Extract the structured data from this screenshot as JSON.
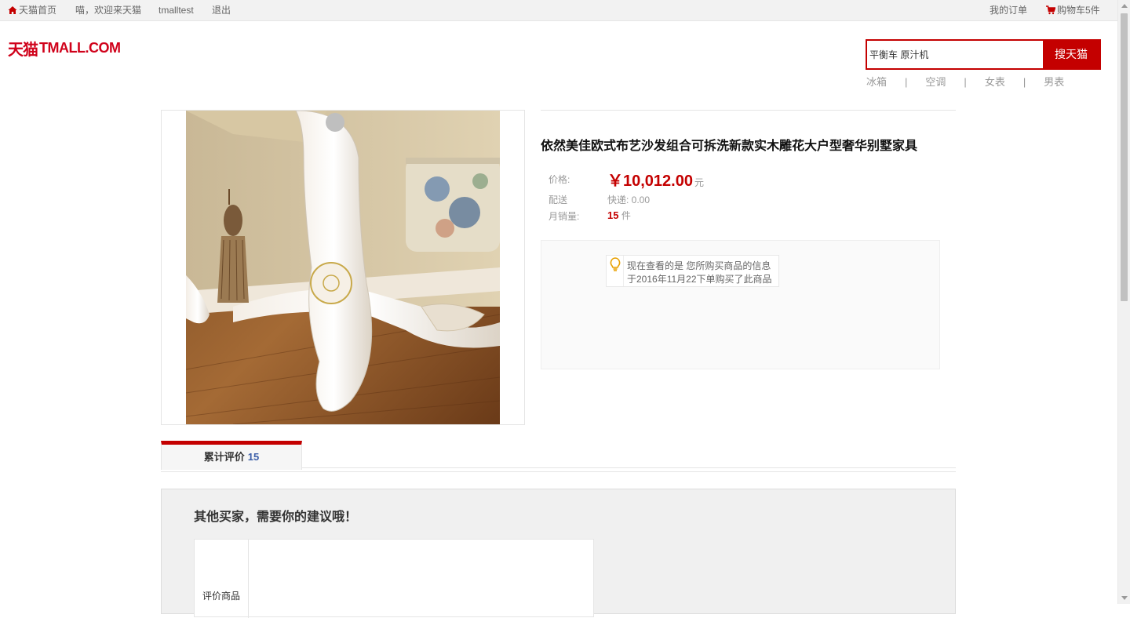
{
  "topbar": {
    "home": "天猫首页",
    "welcome": "喵，欢迎来天猫",
    "user": "tmalltest",
    "logout": "退出",
    "orders": "我的订单",
    "cart": "购物车5件"
  },
  "logo": {
    "cn": "天猫",
    "en": "TMALL.COM"
  },
  "search": {
    "value": "平衡车 原汁机",
    "button": "搜天猫",
    "hotwords": [
      "冰箱",
      "空调",
      "女表",
      "男表"
    ],
    "separator": "|"
  },
  "product": {
    "title": "依然美佳欧式布艺沙发组合可拆洗新款实木雕花大户型奢华别墅家具",
    "price_label": "价格:",
    "price": "￥10,012.00",
    "price_unit": "元",
    "shipping_label": "配送",
    "shipping": "快递: 0.00",
    "sales_label": "月销量:",
    "sales_count": "15",
    "sales_unit": "件"
  },
  "tip": {
    "line1": "现在查看的是 您所购买商品的信息",
    "line2": "于2016年11月22下单购买了此商品"
  },
  "tab": {
    "label": "累计评价",
    "count": "15"
  },
  "review": {
    "heading": "其他买家，需要你的建议哦！",
    "field_label": "评价商品"
  },
  "colors": {
    "brand": "#c40000",
    "count_blue": "#3b5ea8"
  }
}
